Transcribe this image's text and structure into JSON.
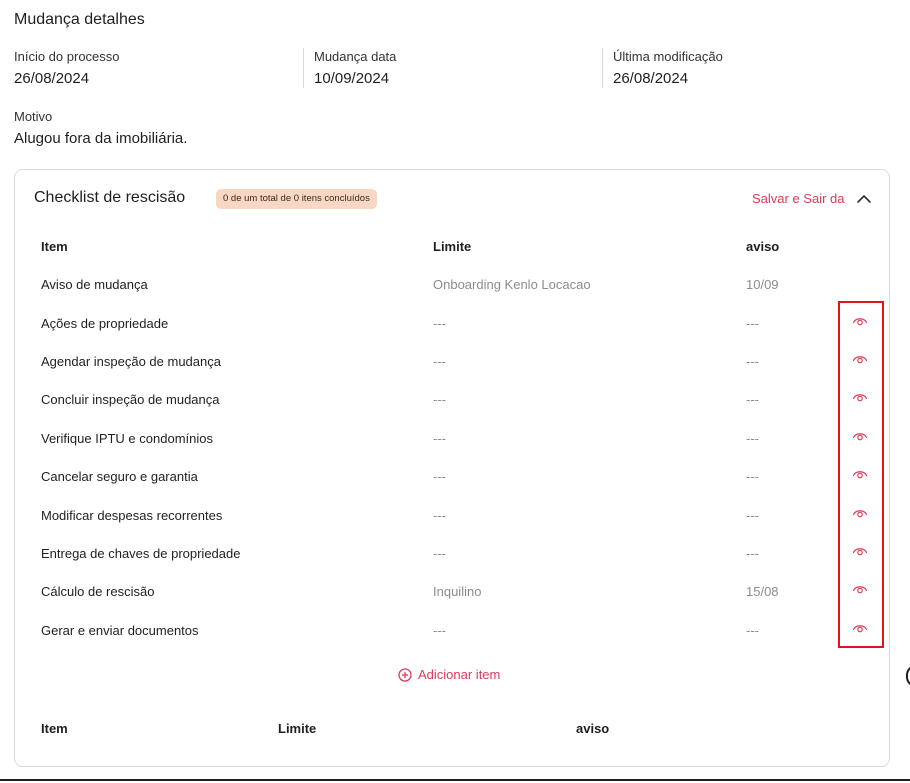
{
  "page": {
    "title": "Mudança detalhes"
  },
  "info": [
    {
      "label": "Início do processo",
      "value": "26/08/2024"
    },
    {
      "label": "Mudança data",
      "value": "10/09/2024"
    },
    {
      "label": "Última modificação",
      "value": "26/08/2024"
    }
  ],
  "reason": {
    "label": "Motivo",
    "value": "Alugou fora da imobiliária."
  },
  "checklist": {
    "title": "Checklist de rescisão",
    "badge": "0 de um total de 0 itens concluídos",
    "save_label": "Salvar e Sair da",
    "columns": {
      "item": "Item",
      "limit": "Limite",
      "notice": "aviso"
    },
    "rows": [
      {
        "item": "Aviso de mudança",
        "limit": "Onboarding Kenlo Locacao",
        "notice": "10/09",
        "eye": false
      },
      {
        "item": "Ações de propriedade",
        "limit": "---",
        "notice": "---",
        "eye": true
      },
      {
        "item": "Agendar inspeção de mudança",
        "limit": "---",
        "notice": "---",
        "eye": true
      },
      {
        "item": "Concluir inspeção de mudança",
        "limit": "---",
        "notice": "---",
        "eye": true
      },
      {
        "item": "Verifique IPTU e condomínios",
        "limit": "---",
        "notice": "---",
        "eye": true
      },
      {
        "item": "Cancelar seguro e garantia",
        "limit": "---",
        "notice": "---",
        "eye": true
      },
      {
        "item": "Modificar despesas recorrentes",
        "limit": "---",
        "notice": "---",
        "eye": true
      },
      {
        "item": "Entrega de chaves de propriedade",
        "limit": "---",
        "notice": "---",
        "eye": true
      },
      {
        "item": "Cálculo de rescisão",
        "limit": "Inquilino",
        "notice": "15/08",
        "eye": true
      },
      {
        "item": "Gerar e enviar documentos",
        "limit": "---",
        "notice": "---",
        "eye": true
      }
    ],
    "add_label": "Adicionar item",
    "footer_columns": {
      "item": "Item",
      "limit": "Limite",
      "notice": "aviso"
    }
  },
  "colors": {
    "accent": "#e03a5a",
    "highlight": "#e0131e",
    "badge_bg": "#f8d8c4"
  },
  "icons": {
    "row_action": "eye-icon",
    "collapse": "chevron-up-icon",
    "add": "plus-circle-icon"
  }
}
